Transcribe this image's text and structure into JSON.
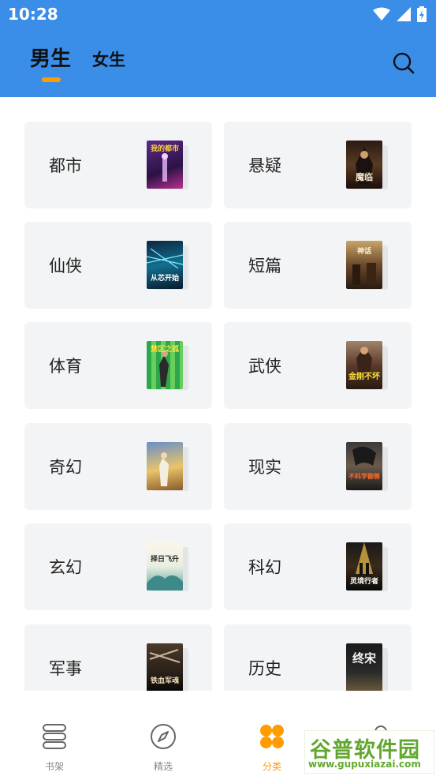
{
  "status": {
    "time": "10:28"
  },
  "header": {
    "tabs": [
      "男生",
      "女生"
    ]
  },
  "categories": [
    {
      "label": "都市",
      "cover_text": "我的都市"
    },
    {
      "label": "悬疑",
      "cover_text": "魔临"
    },
    {
      "label": "仙侠",
      "cover_text": "从芯开始"
    },
    {
      "label": "短篇",
      "cover_text": "神话"
    },
    {
      "label": "体育",
      "cover_text": "禁区之狐"
    },
    {
      "label": "武侠",
      "cover_text": "金刚不坏"
    },
    {
      "label": "奇幻",
      "cover_text": ""
    },
    {
      "label": "现实",
      "cover_text": "不科学御兽"
    },
    {
      "label": "玄幻",
      "cover_text": "择日飞升"
    },
    {
      "label": "科幻",
      "cover_text": "灵境行者"
    },
    {
      "label": "军事",
      "cover_text": "铁血军魂"
    },
    {
      "label": "历史",
      "cover_text": "终宋"
    }
  ],
  "tabbar": {
    "items": [
      "书架",
      "精选",
      "分类",
      "我的"
    ],
    "active": "分类"
  },
  "watermark": {
    "title": "谷普软件园",
    "url": "www.gupuxiazai.com"
  },
  "colors": {
    "header": "#3a8ee8",
    "accent": "#ff9c00",
    "card_bg": "#f3f4f6"
  }
}
